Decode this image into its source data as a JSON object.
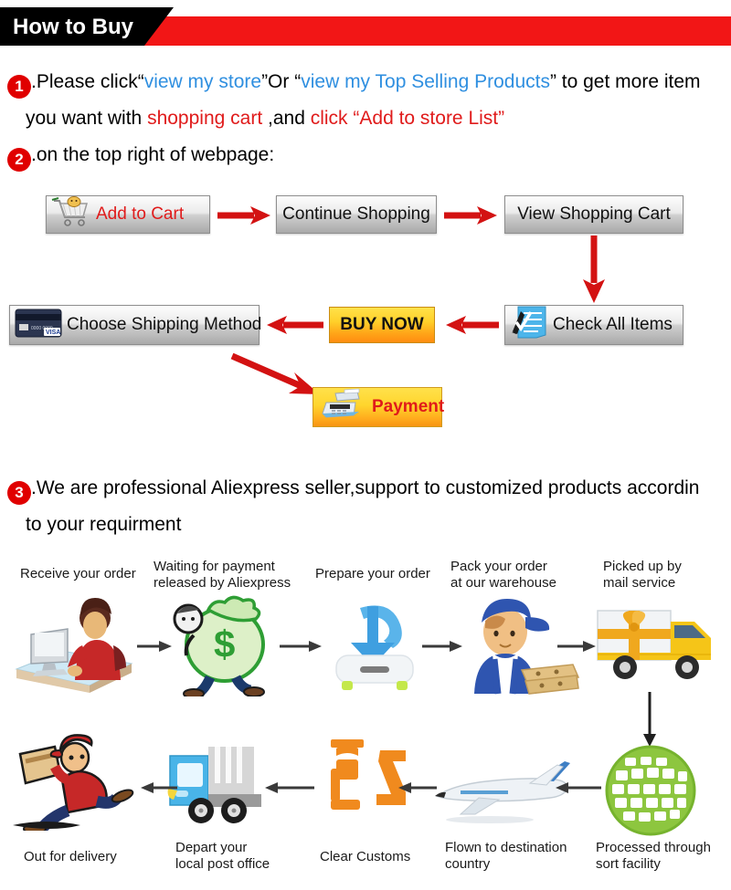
{
  "header": {
    "title": "How to Buy",
    "black_color": "#000000",
    "red_color": "#f21616"
  },
  "steps": {
    "one": {
      "number": "1",
      "seg1": ".Please click“",
      "link1": "view my store",
      "seg2": "”Or “",
      "link2": "view my Top Selling Products",
      "seg3": "” to get more item",
      "line2_seg1": "you want with ",
      "line2_red1": "shopping cart",
      "line2_seg2": " ,and ",
      "line2_red2": "click “Add to store List”"
    },
    "two": {
      "number": "2",
      "text": ".on the top right of webpage:"
    },
    "three": {
      "number": "3",
      "line1": ".We are professional Aliexpress seller,support to customized products accordin",
      "line2": "to your requirment"
    }
  },
  "flow": {
    "add_to_cart": "Add to Cart",
    "continue_shopping": "Continue Shopping",
    "view_shopping_cart": "View Shopping Cart",
    "choose_shipping_method": "Choose Shipping Method",
    "buy_now": "BUY NOW",
    "check_all_items": "Check All Items",
    "payment": "Payment",
    "card_brand": "VISA"
  },
  "shipping": {
    "top_row": [
      "Receive your order",
      "Waiting for payment\nreleased by Aliexpress",
      "Prepare your order",
      "Pack your order\nat our warehouse",
      "Picked up by\nmail service"
    ],
    "top_row_lines": [
      [
        "Receive your order"
      ],
      [
        "Waiting for payment",
        "released by Aliexpress"
      ],
      [
        "Prepare your order"
      ],
      [
        "Pack your order",
        "at our warehouse"
      ],
      [
        "Picked up by",
        "mail service"
      ]
    ],
    "bottom_row_lines": [
      [
        "Out for delivery"
      ],
      [
        "Depart your",
        "local post office"
      ],
      [
        "Clear Customs"
      ],
      [
        "Flown to destination",
        "country"
      ],
      [
        "Processed through",
        "sort facility"
      ]
    ],
    "icons_top": [
      "person-at-computer-icon",
      "money-bag-icon",
      "download-arrow-icon",
      "warehouse-worker-icon",
      "delivery-truck-icon"
    ],
    "icons_bottom": [
      "running-courier-icon",
      "blue-truck-icon",
      "customs-officer-icon",
      "airplane-icon",
      "green-globe-icon"
    ]
  },
  "colors": {
    "red": "#e01b1b",
    "blue_link": "#2f8fe0",
    "orange": "#ff9d14",
    "green": "#8dc63f"
  }
}
